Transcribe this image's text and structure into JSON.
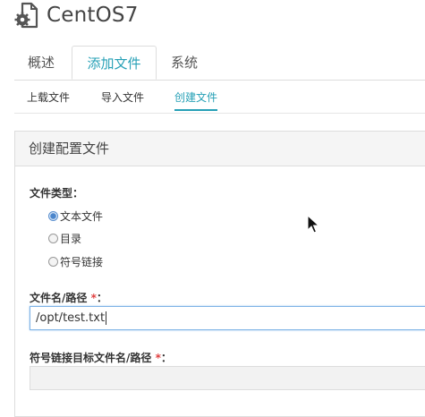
{
  "header": {
    "title": "CentOS7",
    "icon": "gear-document-icon"
  },
  "tabs": [
    {
      "label": "概述"
    },
    {
      "label": "添加文件",
      "active": true
    },
    {
      "label": "系统"
    }
  ],
  "subtabs": [
    {
      "label": "上载文件"
    },
    {
      "label": "导入文件"
    },
    {
      "label": "创建文件",
      "active": true
    }
  ],
  "panel": {
    "title": "创建配置文件",
    "file_type_label": "文件类型：",
    "options": [
      {
        "label": "文本文件",
        "checked": true
      },
      {
        "label": "目录"
      },
      {
        "label": "符号链接"
      }
    ],
    "path_label": "文件名/路径",
    "path_value": "/opt/test.txt",
    "symlink_label": "符号链接目标文件名/路径",
    "required_mark": "*",
    "colon": "："
  },
  "colors": {
    "accent": "#26a0b6",
    "required": "#e04040"
  }
}
